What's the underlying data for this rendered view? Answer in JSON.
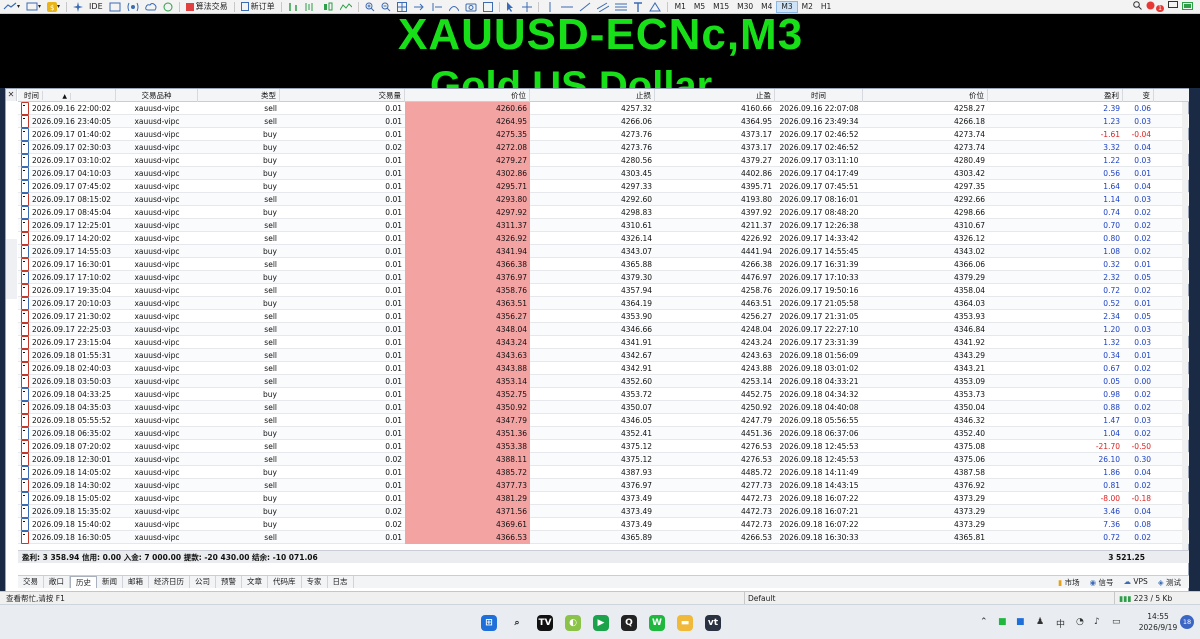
{
  "toolbar": {
    "algo_trading": "算法交易",
    "new_order": "新订单",
    "ide": "IDE",
    "timeframes": [
      "M1",
      "M5",
      "M15",
      "M30",
      "M4",
      "M3",
      "M2",
      "H1"
    ],
    "active_timeframe": "M3",
    "alert_count": "1"
  },
  "chart": {
    "title": "XAUUSD-ECNc,M3",
    "subtitle": "Gold US Dollar"
  },
  "table": {
    "headers": [
      "时间",
      "交易品种",
      "类型",
      "交易量",
      "价位",
      "止损",
      "止盈",
      "时间",
      "价位",
      "盈利",
      "变"
    ],
    "rows": [
      [
        "2026.09.16 22:00:02",
        "xauusd-vipc",
        "sell",
        "0.01",
        "4260.66",
        "4257.32",
        "4160.66",
        "2026.09.16 22:07:08",
        "4258.27",
        "2.39",
        "0.06"
      ],
      [
        "2026.09.16 23:40:05",
        "xauusd-vipc",
        "sell",
        "0.01",
        "4264.95",
        "4266.06",
        "4364.95",
        "2026.09.16 23:49:34",
        "4266.18",
        "1.23",
        "0.03"
      ],
      [
        "2026.09.17 01:40:02",
        "xauusd-vipc",
        "buy",
        "0.01",
        "4275.35",
        "4273.76",
        "4373.17",
        "2026.09.17 02:46:52",
        "4273.74",
        "-1.61",
        "-0.04"
      ],
      [
        "2026.09.17 02:30:03",
        "xauusd-vipc",
        "buy",
        "0.02",
        "4272.08",
        "4273.76",
        "4373.17",
        "2026.09.17 02:46:52",
        "4273.74",
        "3.32",
        "0.04"
      ],
      [
        "2026.09.17 03:10:02",
        "xauusd-vipc",
        "buy",
        "0.01",
        "4279.27",
        "4280.56",
        "4379.27",
        "2026.09.17 03:11:10",
        "4280.49",
        "1.22",
        "0.03"
      ],
      [
        "2026.09.17 04:10:03",
        "xauusd-vipc",
        "buy",
        "0.01",
        "4302.86",
        "4303.45",
        "4402.86",
        "2026.09.17 04:17:49",
        "4303.42",
        "0.56",
        "0.01"
      ],
      [
        "2026.09.17 07:45:02",
        "xauusd-vipc",
        "buy",
        "0.01",
        "4295.71",
        "4297.33",
        "4395.71",
        "2026.09.17 07:45:51",
        "4297.35",
        "1.64",
        "0.04"
      ],
      [
        "2026.09.17 08:15:02",
        "xauusd-vipc",
        "sell",
        "0.01",
        "4293.80",
        "4292.60",
        "4193.80",
        "2026.09.17 08:16:01",
        "4292.66",
        "1.14",
        "0.03"
      ],
      [
        "2026.09.17 08:45:04",
        "xauusd-vipc",
        "buy",
        "0.01",
        "4297.92",
        "4298.83",
        "4397.92",
        "2026.09.17 08:48:20",
        "4298.66",
        "0.74",
        "0.02"
      ],
      [
        "2026.09.17 12:25:01",
        "xauusd-vipc",
        "sell",
        "0.01",
        "4311.37",
        "4310.61",
        "4211.37",
        "2026.09.17 12:26:38",
        "4310.67",
        "0.70",
        "0.02"
      ],
      [
        "2026.09.17 14:20:02",
        "xauusd-vipc",
        "sell",
        "0.01",
        "4326.92",
        "4326.14",
        "4226.92",
        "2026.09.17 14:33:42",
        "4326.12",
        "0.80",
        "0.02"
      ],
      [
        "2026.09.17 14:55:03",
        "xauusd-vipc",
        "buy",
        "0.01",
        "4341.94",
        "4343.07",
        "4441.94",
        "2026.09.17 14:55:45",
        "4343.02",
        "1.08",
        "0.02"
      ],
      [
        "2026.09.17 16:30:01",
        "xauusd-vipc",
        "sell",
        "0.01",
        "4366.38",
        "4365.88",
        "4266.38",
        "2026.09.17 16:31:39",
        "4366.06",
        "0.32",
        "0.01"
      ],
      [
        "2026.09.17 17:10:02",
        "xauusd-vipc",
        "buy",
        "0.01",
        "4376.97",
        "4379.30",
        "4476.97",
        "2026.09.17 17:10:33",
        "4379.29",
        "2.32",
        "0.05"
      ],
      [
        "2026.09.17 19:35:04",
        "xauusd-vipc",
        "sell",
        "0.01",
        "4358.76",
        "4357.94",
        "4258.76",
        "2026.09.17 19:50:16",
        "4358.04",
        "0.72",
        "0.02"
      ],
      [
        "2026.09.17 20:10:03",
        "xauusd-vipc",
        "buy",
        "0.01",
        "4363.51",
        "4364.19",
        "4463.51",
        "2026.09.17 21:05:58",
        "4364.03",
        "0.52",
        "0.01"
      ],
      [
        "2026.09.17 21:30:02",
        "xauusd-vipc",
        "sell",
        "0.01",
        "4356.27",
        "4353.90",
        "4256.27",
        "2026.09.17 21:31:05",
        "4353.93",
        "2.34",
        "0.05"
      ],
      [
        "2026.09.17 22:25:03",
        "xauusd-vipc",
        "sell",
        "0.01",
        "4348.04",
        "4346.66",
        "4248.04",
        "2026.09.17 22:27:10",
        "4346.84",
        "1.20",
        "0.03"
      ],
      [
        "2026.09.17 23:15:04",
        "xauusd-vipc",
        "sell",
        "0.01",
        "4343.24",
        "4341.91",
        "4243.24",
        "2026.09.17 23:31:39",
        "4341.92",
        "1.32",
        "0.03"
      ],
      [
        "2026.09.18 01:55:31",
        "xauusd-vipc",
        "sell",
        "0.01",
        "4343.63",
        "4342.67",
        "4243.63",
        "2026.09.18 01:56:09",
        "4343.29",
        "0.34",
        "0.01"
      ],
      [
        "2026.09.18 02:40:03",
        "xauusd-vipc",
        "sell",
        "0.01",
        "4343.88",
        "4342.91",
        "4243.88",
        "2026.09.18 03:01:02",
        "4343.21",
        "0.67",
        "0.02"
      ],
      [
        "2026.09.18 03:50:03",
        "xauusd-vipc",
        "sell",
        "0.01",
        "4353.14",
        "4352.60",
        "4253.14",
        "2026.09.18 04:33:21",
        "4353.09",
        "0.05",
        "0.00"
      ],
      [
        "2026.09.18 04:33:25",
        "xauusd-vipc",
        "buy",
        "0.01",
        "4352.75",
        "4353.72",
        "4452.75",
        "2026.09.18 04:34:32",
        "4353.73",
        "0.98",
        "0.02"
      ],
      [
        "2026.09.18 04:35:03",
        "xauusd-vipc",
        "sell",
        "0.01",
        "4350.92",
        "4350.07",
        "4250.92",
        "2026.09.18 04:40:08",
        "4350.04",
        "0.88",
        "0.02"
      ],
      [
        "2026.09.18 05:55:52",
        "xauusd-vipc",
        "sell",
        "0.01",
        "4347.79",
        "4346.05",
        "4247.79",
        "2026.09.18 05:56:55",
        "4346.32",
        "1.47",
        "0.03"
      ],
      [
        "2026.09.18 06:35:02",
        "xauusd-vipc",
        "buy",
        "0.01",
        "4351.36",
        "4352.41",
        "4451.36",
        "2026.09.18 06:37:06",
        "4352.40",
        "1.04",
        "0.02"
      ],
      [
        "2026.09.18 07:20:02",
        "xauusd-vipc",
        "sell",
        "0.01",
        "4353.38",
        "4375.12",
        "4276.53",
        "2026.09.18 12:45:53",
        "4375.08",
        "-21.70",
        "-0.50"
      ],
      [
        "2026.09.18 12:30:01",
        "xauusd-vipc",
        "sell",
        "0.02",
        "4388.11",
        "4375.12",
        "4276.53",
        "2026.09.18 12:45:53",
        "4375.06",
        "26.10",
        "0.30"
      ],
      [
        "2026.09.18 14:05:02",
        "xauusd-vipc",
        "buy",
        "0.01",
        "4385.72",
        "4387.93",
        "4485.72",
        "2026.09.18 14:11:49",
        "4387.58",
        "1.86",
        "0.04"
      ],
      [
        "2026.09.18 14:30:02",
        "xauusd-vipc",
        "sell",
        "0.01",
        "4377.73",
        "4376.97",
        "4277.73",
        "2026.09.18 14:43:15",
        "4376.92",
        "0.81",
        "0.02"
      ],
      [
        "2026.09.18 15:05:02",
        "xauusd-vipc",
        "buy",
        "0.01",
        "4381.29",
        "4373.49",
        "4472.73",
        "2026.09.18 16:07:22",
        "4373.29",
        "-8.00",
        "-0.18"
      ],
      [
        "2026.09.18 15:35:02",
        "xauusd-vipc",
        "buy",
        "0.02",
        "4371.56",
        "4373.49",
        "4472.73",
        "2026.09.18 16:07:21",
        "4373.29",
        "3.46",
        "0.04"
      ],
      [
        "2026.09.18 15:40:02",
        "xauusd-vipc",
        "buy",
        "0.02",
        "4369.61",
        "4373.49",
        "4472.73",
        "2026.09.18 16:07:22",
        "4373.29",
        "7.36",
        "0.08"
      ],
      [
        "2026.09.18 16:30:05",
        "xauusd-vipc",
        "sell",
        "0.01",
        "4366.53",
        "4365.89",
        "4266.53",
        "2026.09.18 16:30:33",
        "4365.81",
        "0.72",
        "0.02"
      ]
    ]
  },
  "summary": {
    "text": "盈利: 3 358.94  信用: 0.00  入金: 7 000.00  提款: -20 430.00  结余: -10 071.06",
    "total": "3 521.25"
  },
  "tabs": {
    "items": [
      "交易",
      "敞口",
      "历史",
      "新闻",
      "邮箱",
      "经济日历",
      "公司",
      "预警",
      "文章",
      "代码库",
      "专家",
      "日志"
    ],
    "active": "历史",
    "right": [
      "市场",
      "信号",
      "VPS",
      "测试"
    ]
  },
  "statusbar": {
    "help": "查看帮忙,请按 F1",
    "profile": "Default",
    "net": "223 / 5 Kb"
  },
  "taskbar": {
    "ime": "中",
    "time": "14:55",
    "date": "2026/9/19",
    "notifications": "18"
  },
  "colors": {
    "chart_text": "#18e018",
    "stoploss_bg": "#f4a3a3",
    "profit_pos": "#1a3fc4",
    "profit_neg": "#e02020"
  }
}
